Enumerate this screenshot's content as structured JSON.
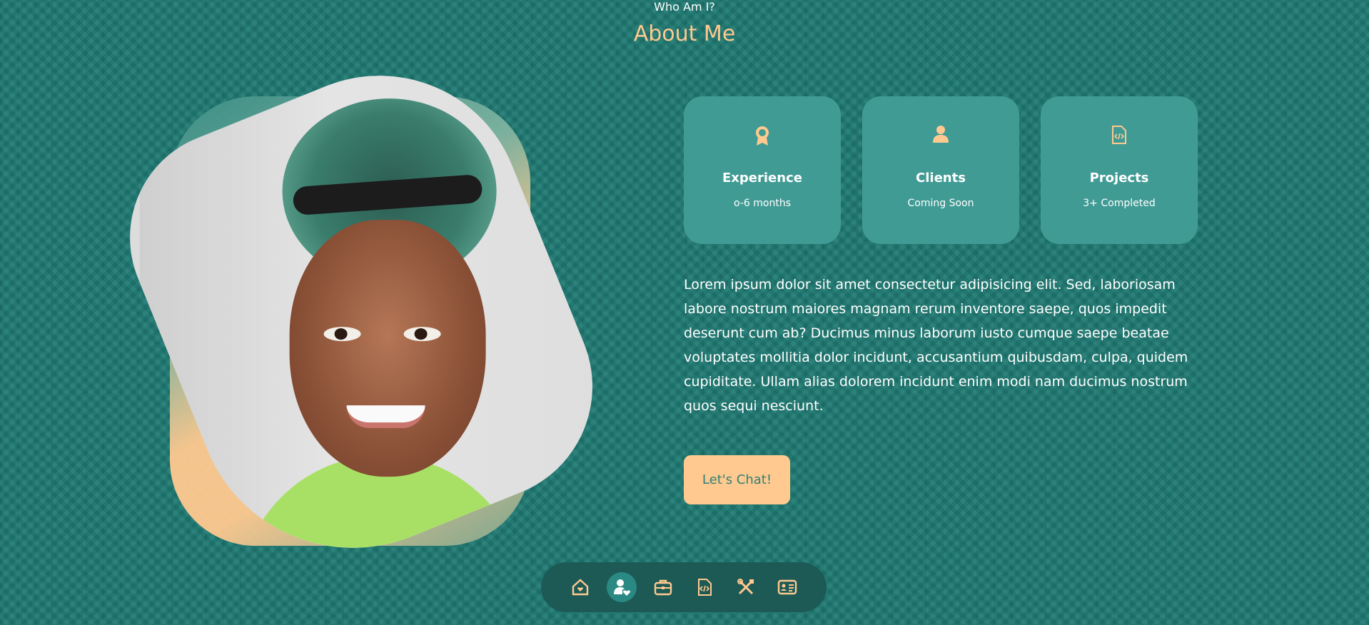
{
  "section": {
    "subtitle": "Who Am I?",
    "title": "About Me"
  },
  "cards": [
    {
      "icon": "award-icon",
      "title": "Experience",
      "value": "o-6 months"
    },
    {
      "icon": "user-icon",
      "title": "Clients",
      "value": "Coming Soon"
    },
    {
      "icon": "code-file-icon",
      "title": "Projects",
      "value": "3+ Completed"
    }
  ],
  "description": "Lorem ipsum dolor sit amet consectetur adipisicing elit. Sed, laboriosam labore nostrum maiores magnam rerum inventore saepe, quos impedit deserunt cum ab? Ducimus minus laborum iusto cumque saepe beatae voluptates mollitia dolor incidunt, accusantium quibusdam, culpa, quidem cupiditate. Ullam alias dolorem incidunt enim modi nam ducimus nostrum quos sequi nesciunt.",
  "cta": {
    "label": "Let's Chat!"
  },
  "nav": {
    "items": [
      {
        "icon": "home-heart-icon",
        "active": false
      },
      {
        "icon": "user-heart-icon",
        "active": true
      },
      {
        "icon": "briefcase-icon",
        "active": false
      },
      {
        "icon": "code-file-icon",
        "active": false
      },
      {
        "icon": "tools-icon",
        "active": false
      },
      {
        "icon": "contact-card-icon",
        "active": false
      }
    ]
  },
  "colors": {
    "background": "#1f7a73",
    "accent": "#ffc98f",
    "card": "#419b95",
    "nav": "#1d5a55"
  }
}
